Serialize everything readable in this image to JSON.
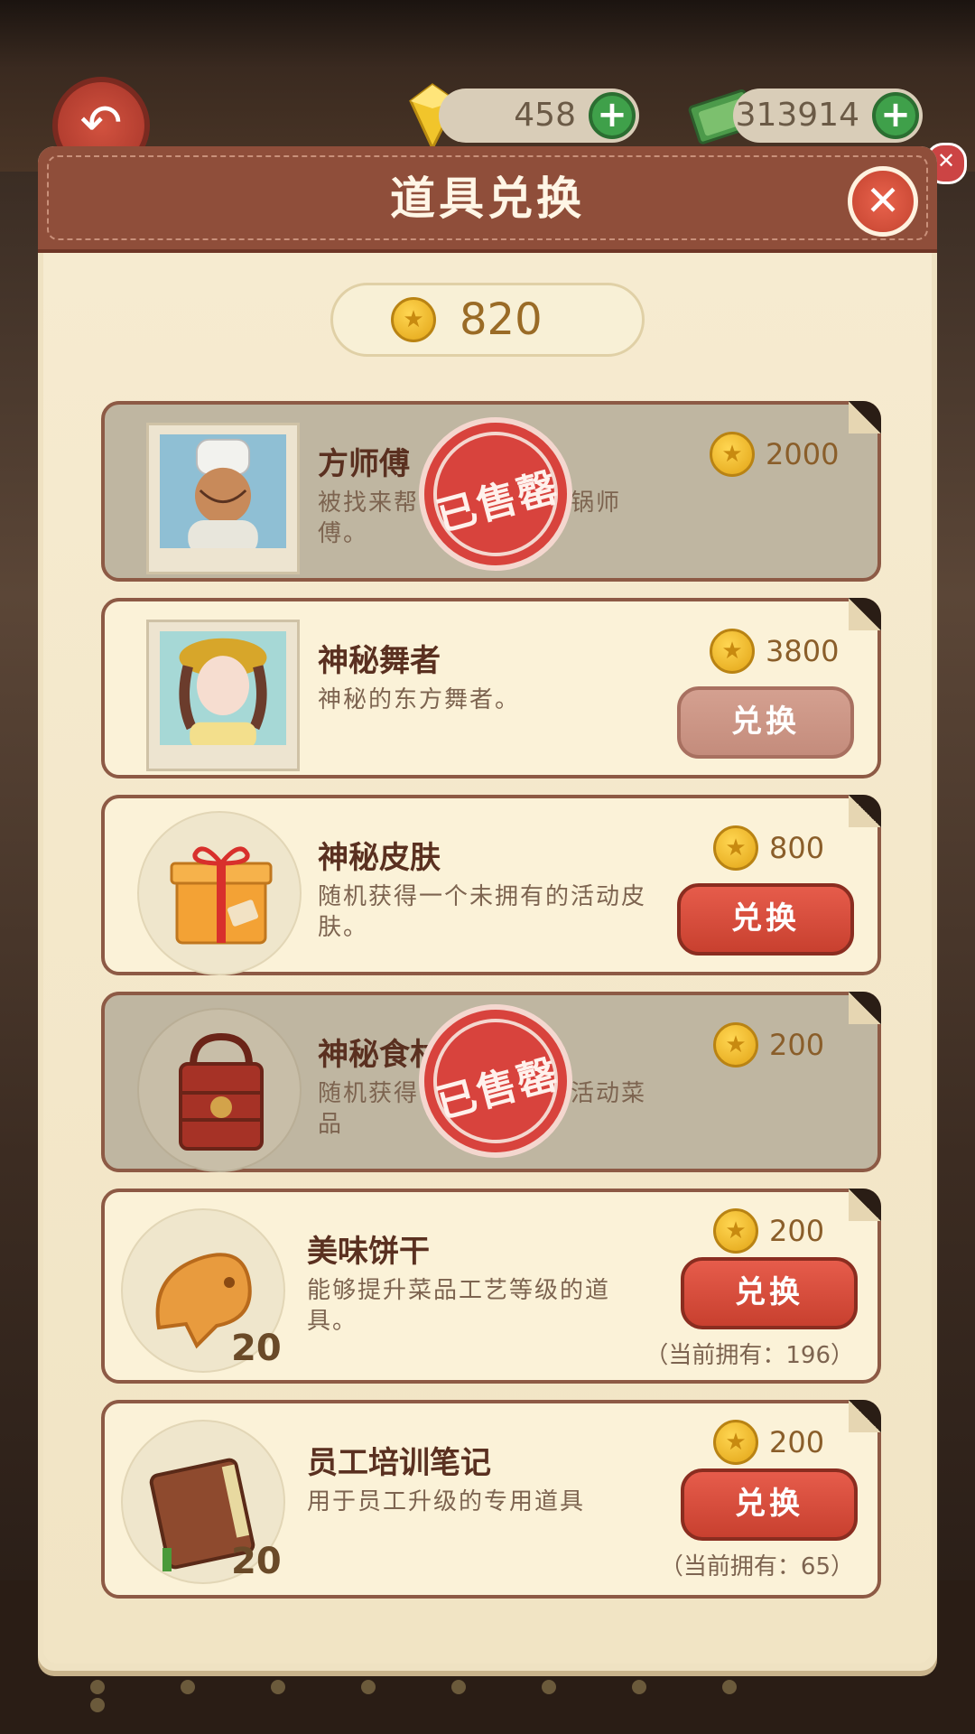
{
  "hud": {
    "gems": "458",
    "cash": "313914",
    "plus": "+",
    "back_icon": "back-arrow-icon"
  },
  "dialog": {
    "title": "道具兑换",
    "close_icon": "close-icon",
    "coin_balance": "820"
  },
  "items": [
    {
      "name": "方师傅",
      "desc": "被找来帮　　　　　端锅师傅。",
      "price": "2000",
      "status": "sold",
      "stamp": "已售罄"
    },
    {
      "name": "神秘舞者",
      "desc": "神秘的东方舞者。",
      "price": "3800",
      "button": "兑换",
      "button_state": "disabled"
    },
    {
      "name": "神秘皮肤",
      "desc": "随机获得一个未拥有的活动皮肤。",
      "price": "800",
      "button": "兑换"
    },
    {
      "name": "神秘食材",
      "desc": "随机获得　　　　　的活动菜品",
      "price": "200",
      "status": "sold",
      "stamp": "已售罄"
    },
    {
      "name": "美味饼干",
      "desc": "能够提升菜品工艺等级的道具。",
      "price": "200",
      "button": "兑换",
      "count": "20",
      "owned": "（当前拥有：196）"
    },
    {
      "name": "员工培训笔记",
      "desc": "用于员工升级的专用道具",
      "price": "200",
      "button": "兑换",
      "count": "20",
      "owned": "（当前拥有：65）"
    }
  ]
}
